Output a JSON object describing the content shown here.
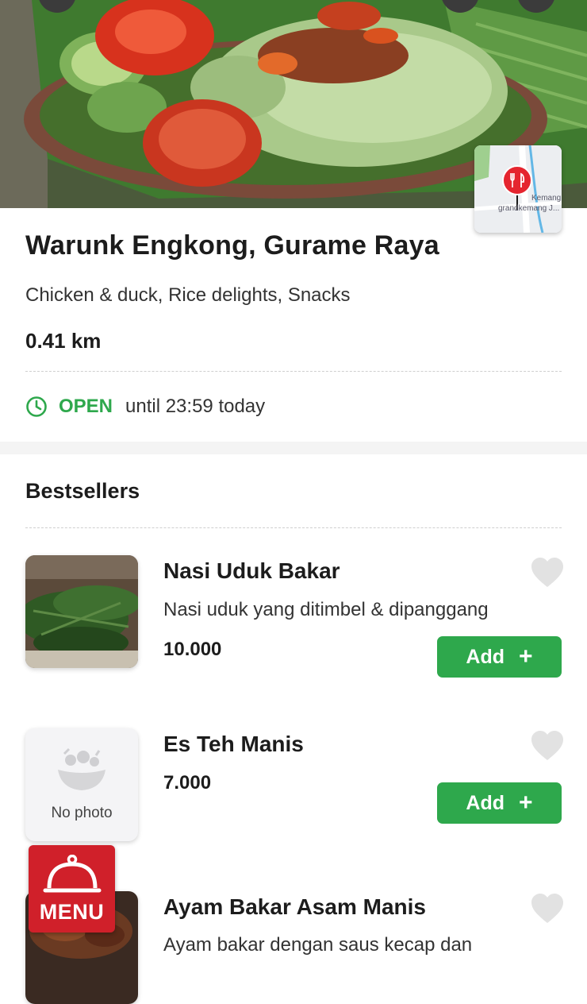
{
  "restaurant": {
    "name": "Warunk Engkong, Gurame Raya",
    "cuisines": "Chicken & duck, Rice delights, Snacks",
    "distance": "0.41 km",
    "status": "OPEN",
    "hours_text": "until 23:59 today"
  },
  "map": {
    "label_1": "Kemang",
    "label_2": "grandkemang J..."
  },
  "bestsellers": {
    "title": "Bestsellers",
    "items": [
      {
        "name": "Nasi Uduk Bakar",
        "description": "Nasi uduk yang ditimbel & dipanggang",
        "price": "10.000",
        "add_label": "Add"
      },
      {
        "name": "Es Teh Manis",
        "description": "",
        "price": "7.000",
        "add_label": "Add",
        "placeholder_text": "No photo"
      },
      {
        "name": "Ayam Bakar Asam Manis",
        "description": "Ayam bakar dengan saus kecap dan"
      }
    ]
  },
  "menu_button": {
    "label": "MENU"
  },
  "colors": {
    "accent_green": "#2ea84c",
    "menu_red": "#d0202a"
  },
  "icons": [
    "clock-icon",
    "heart-icon",
    "plus-icon",
    "restaurant-pin-icon",
    "cloche-icon",
    "no-photo-icon"
  ]
}
